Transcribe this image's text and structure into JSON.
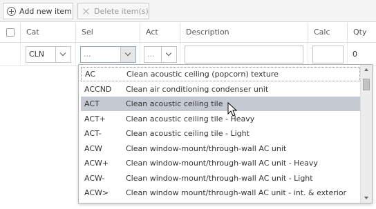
{
  "toolbar": {
    "add_label": "Add new item",
    "delete_label": "Delete item(s)"
  },
  "grid": {
    "columns": [
      "Cat",
      "Sel",
      "Act",
      "Description",
      "Calc",
      "Qty"
    ],
    "row": {
      "cat": "CLN",
      "sel": "...",
      "act": "...",
      "description": "",
      "calc": "",
      "qty": "0"
    }
  },
  "dropdown": {
    "highlighted_index": 2,
    "items": [
      {
        "code": "AC",
        "desc": "Clean acoustic ceiling (popcorn) texture"
      },
      {
        "code": "ACCND",
        "desc": "Clean air conditioning condenser unit"
      },
      {
        "code": "ACT",
        "desc": "Clean acoustic ceiling tile"
      },
      {
        "code": "ACT+",
        "desc": "Clean acoustic ceiling tile - Heavy"
      },
      {
        "code": "ACT-",
        "desc": "Clean acoustic ceiling tile - Light"
      },
      {
        "code": "ACW",
        "desc": "Clean window-mount/through-wall AC unit"
      },
      {
        "code": "ACW+",
        "desc": "Clean window-mount/through-wall AC unit - Heavy"
      },
      {
        "code": "ACW-",
        "desc": "Clean window-mount/through-wall AC unit - Light"
      },
      {
        "code": "ACW>",
        "desc": "Clean window mount/through-wall AC unit - int. & exterior"
      }
    ]
  },
  "colors": {
    "highlight": "#c5cad2",
    "toolbar_bg": "#f4f4f4",
    "border": "#c4c4c4"
  }
}
